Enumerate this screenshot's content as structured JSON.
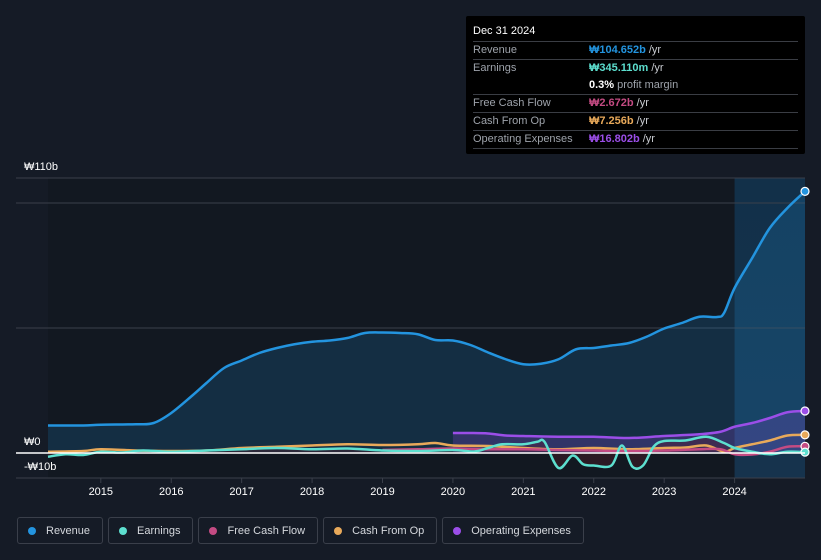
{
  "tooltip": {
    "date": "Dec 31 2024",
    "rows": [
      {
        "label": "Revenue",
        "value": "₩104.652b",
        "unit": "/yr",
        "color": "#2394df"
      },
      {
        "label": "Earnings",
        "value": "₩345.110m",
        "unit": "/yr",
        "color": "#5ddfcf"
      },
      {
        "label": "Free Cash Flow",
        "value": "₩2.672b",
        "unit": "/yr",
        "color": "#c44b83"
      },
      {
        "label": "Cash From Op",
        "value": "₩7.256b",
        "unit": "/yr",
        "color": "#e8a95a"
      },
      {
        "label": "Operating Expenses",
        "value": "₩16.802b",
        "unit": "/yr",
        "color": "#9b4ee8"
      }
    ],
    "profit_margin_pct": "0.3%",
    "profit_margin_text": "profit margin"
  },
  "legend": [
    {
      "label": "Revenue",
      "color": "#2394df"
    },
    {
      "label": "Earnings",
      "color": "#5ddfcf"
    },
    {
      "label": "Free Cash Flow",
      "color": "#c44b83"
    },
    {
      "label": "Cash From Op",
      "color": "#e8a95a"
    },
    {
      "label": "Operating Expenses",
      "color": "#9b4ee8"
    }
  ],
  "chart_data": {
    "type": "line",
    "title": "",
    "xlabel": "",
    "ylabel": "",
    "currency": "KRW",
    "ylim": [
      -10,
      110
    ],
    "ytick_labels": [
      "₩110b",
      "₩0",
      "-₩10b"
    ],
    "ytick_values": [
      110,
      0,
      -10
    ],
    "xlim": [
      2014.25,
      2025.0
    ],
    "xtick_labels": [
      "2015",
      "2016",
      "2017",
      "2018",
      "2019",
      "2020",
      "2021",
      "2022",
      "2023",
      "2024"
    ],
    "xtick_values": [
      2015,
      2016,
      2017,
      2018,
      2019,
      2020,
      2021,
      2022,
      2023,
      2024
    ],
    "gridlines": [
      110,
      100,
      50
    ],
    "highlight_from": 2024.0,
    "grid": true,
    "legend_position": "bottom-left",
    "series": [
      {
        "name": "Revenue",
        "color": "#2394df",
        "fill": true,
        "x": [
          2014.25,
          2014.75,
          2015.0,
          2015.5,
          2015.75,
          2016.0,
          2016.3,
          2016.5,
          2016.75,
          2017.0,
          2017.25,
          2017.5,
          2017.75,
          2018.0,
          2018.25,
          2018.5,
          2018.75,
          2019.0,
          2019.25,
          2019.5,
          2019.75,
          2020.0,
          2020.25,
          2020.5,
          2020.75,
          2021.0,
          2021.25,
          2021.5,
          2021.75,
          2022.0,
          2022.25,
          2022.5,
          2022.75,
          2023.0,
          2023.25,
          2023.5,
          2023.75,
          2023.85,
          2024.0,
          2024.25,
          2024.5,
          2024.75,
          2025.0
        ],
        "y": [
          11,
          11,
          11.3,
          11.5,
          12,
          16,
          23,
          28,
          34,
          37,
          40,
          42,
          43.5,
          44.5,
          45,
          46,
          48,
          48.2,
          48,
          47.5,
          45.2,
          45,
          43.2,
          40.2,
          37.5,
          35.5,
          35.7,
          37.5,
          41.5,
          42,
          43,
          44,
          46.5,
          49.8,
          52,
          54.5,
          54.4,
          56,
          66,
          78,
          90,
          98,
          104.65
        ]
      },
      {
        "name": "Earnings",
        "color": "#5ddfcf",
        "fill": false,
        "x": [
          2014.25,
          2014.5,
          2014.75,
          2015.0,
          2015.3,
          2015.6,
          2016.0,
          2016.5,
          2017.0,
          2017.5,
          2018.0,
          2018.5,
          2019.0,
          2019.5,
          2020.0,
          2020.3,
          2020.5,
          2020.7,
          2021.0,
          2021.2,
          2021.3,
          2021.5,
          2021.7,
          2021.85,
          2022.0,
          2022.25,
          2022.4,
          2022.55,
          2022.7,
          2022.85,
          2023.0,
          2023.3,
          2023.6,
          2023.85,
          2024.0,
          2024.25,
          2024.5,
          2024.75,
          2025.0
        ],
        "y": [
          -1.5,
          -0.5,
          -0.8,
          0.5,
          0.2,
          1,
          0.5,
          1,
          1.5,
          2,
          1.5,
          1.8,
          1,
          0.8,
          1.2,
          0.6,
          2,
          3.5,
          3.5,
          4.5,
          4.5,
          -6,
          -1,
          -4.5,
          -5,
          -5,
          3,
          -5.5,
          -5,
          2.5,
          4.8,
          5,
          6.5,
          4,
          2,
          0.5,
          -0.5,
          0.5,
          0.35
        ]
      },
      {
        "name": "Free Cash Flow",
        "color": "#c44b83",
        "fill": false,
        "x": [
          2019.0,
          2019.5,
          2020.0,
          2020.5,
          2021.0,
          2021.5,
          2022.0,
          2022.5,
          2023.0,
          2023.5,
          2023.8,
          2024.0,
          2024.25,
          2024.5,
          2024.75,
          2025.0
        ],
        "y": [
          1.2,
          1.5,
          1.8,
          1.5,
          1.5,
          1.2,
          1,
          0.8,
          1,
          1.5,
          1.5,
          -0.5,
          -0.6,
          0.5,
          2.5,
          2.67
        ]
      },
      {
        "name": "Cash From Op",
        "color": "#e8a95a",
        "fill": false,
        "x": [
          2014.25,
          2014.75,
          2015.0,
          2015.5,
          2016.0,
          2016.5,
          2017.0,
          2017.5,
          2018.0,
          2018.5,
          2019.0,
          2019.5,
          2019.75,
          2020.0,
          2020.5,
          2021.0,
          2021.5,
          2022.0,
          2022.5,
          2023.0,
          2023.3,
          2023.6,
          2023.85,
          2024.0,
          2024.25,
          2024.5,
          2024.75,
          2025.0
        ],
        "y": [
          0.5,
          0.8,
          1.5,
          1,
          0.8,
          1,
          2,
          2.5,
          3,
          3.5,
          3.2,
          3.5,
          4,
          3,
          2.8,
          2,
          1.5,
          2,
          1.5,
          2,
          2.2,
          3,
          0.5,
          2,
          3.5,
          5,
          7,
          7.26
        ]
      },
      {
        "name": "Operating Expenses",
        "color": "#9b4ee8",
        "fill": true,
        "x": [
          2020.0,
          2020.25,
          2020.5,
          2020.75,
          2021.0,
          2021.5,
          2022.0,
          2022.5,
          2023.0,
          2023.5,
          2023.8,
          2024.0,
          2024.25,
          2024.5,
          2024.75,
          2025.0
        ],
        "y": [
          8,
          8,
          7.8,
          7,
          6.8,
          6.5,
          6.5,
          6,
          6.8,
          7.5,
          8.5,
          10.5,
          12,
          14,
          16.3,
          16.8
        ]
      }
    ]
  }
}
